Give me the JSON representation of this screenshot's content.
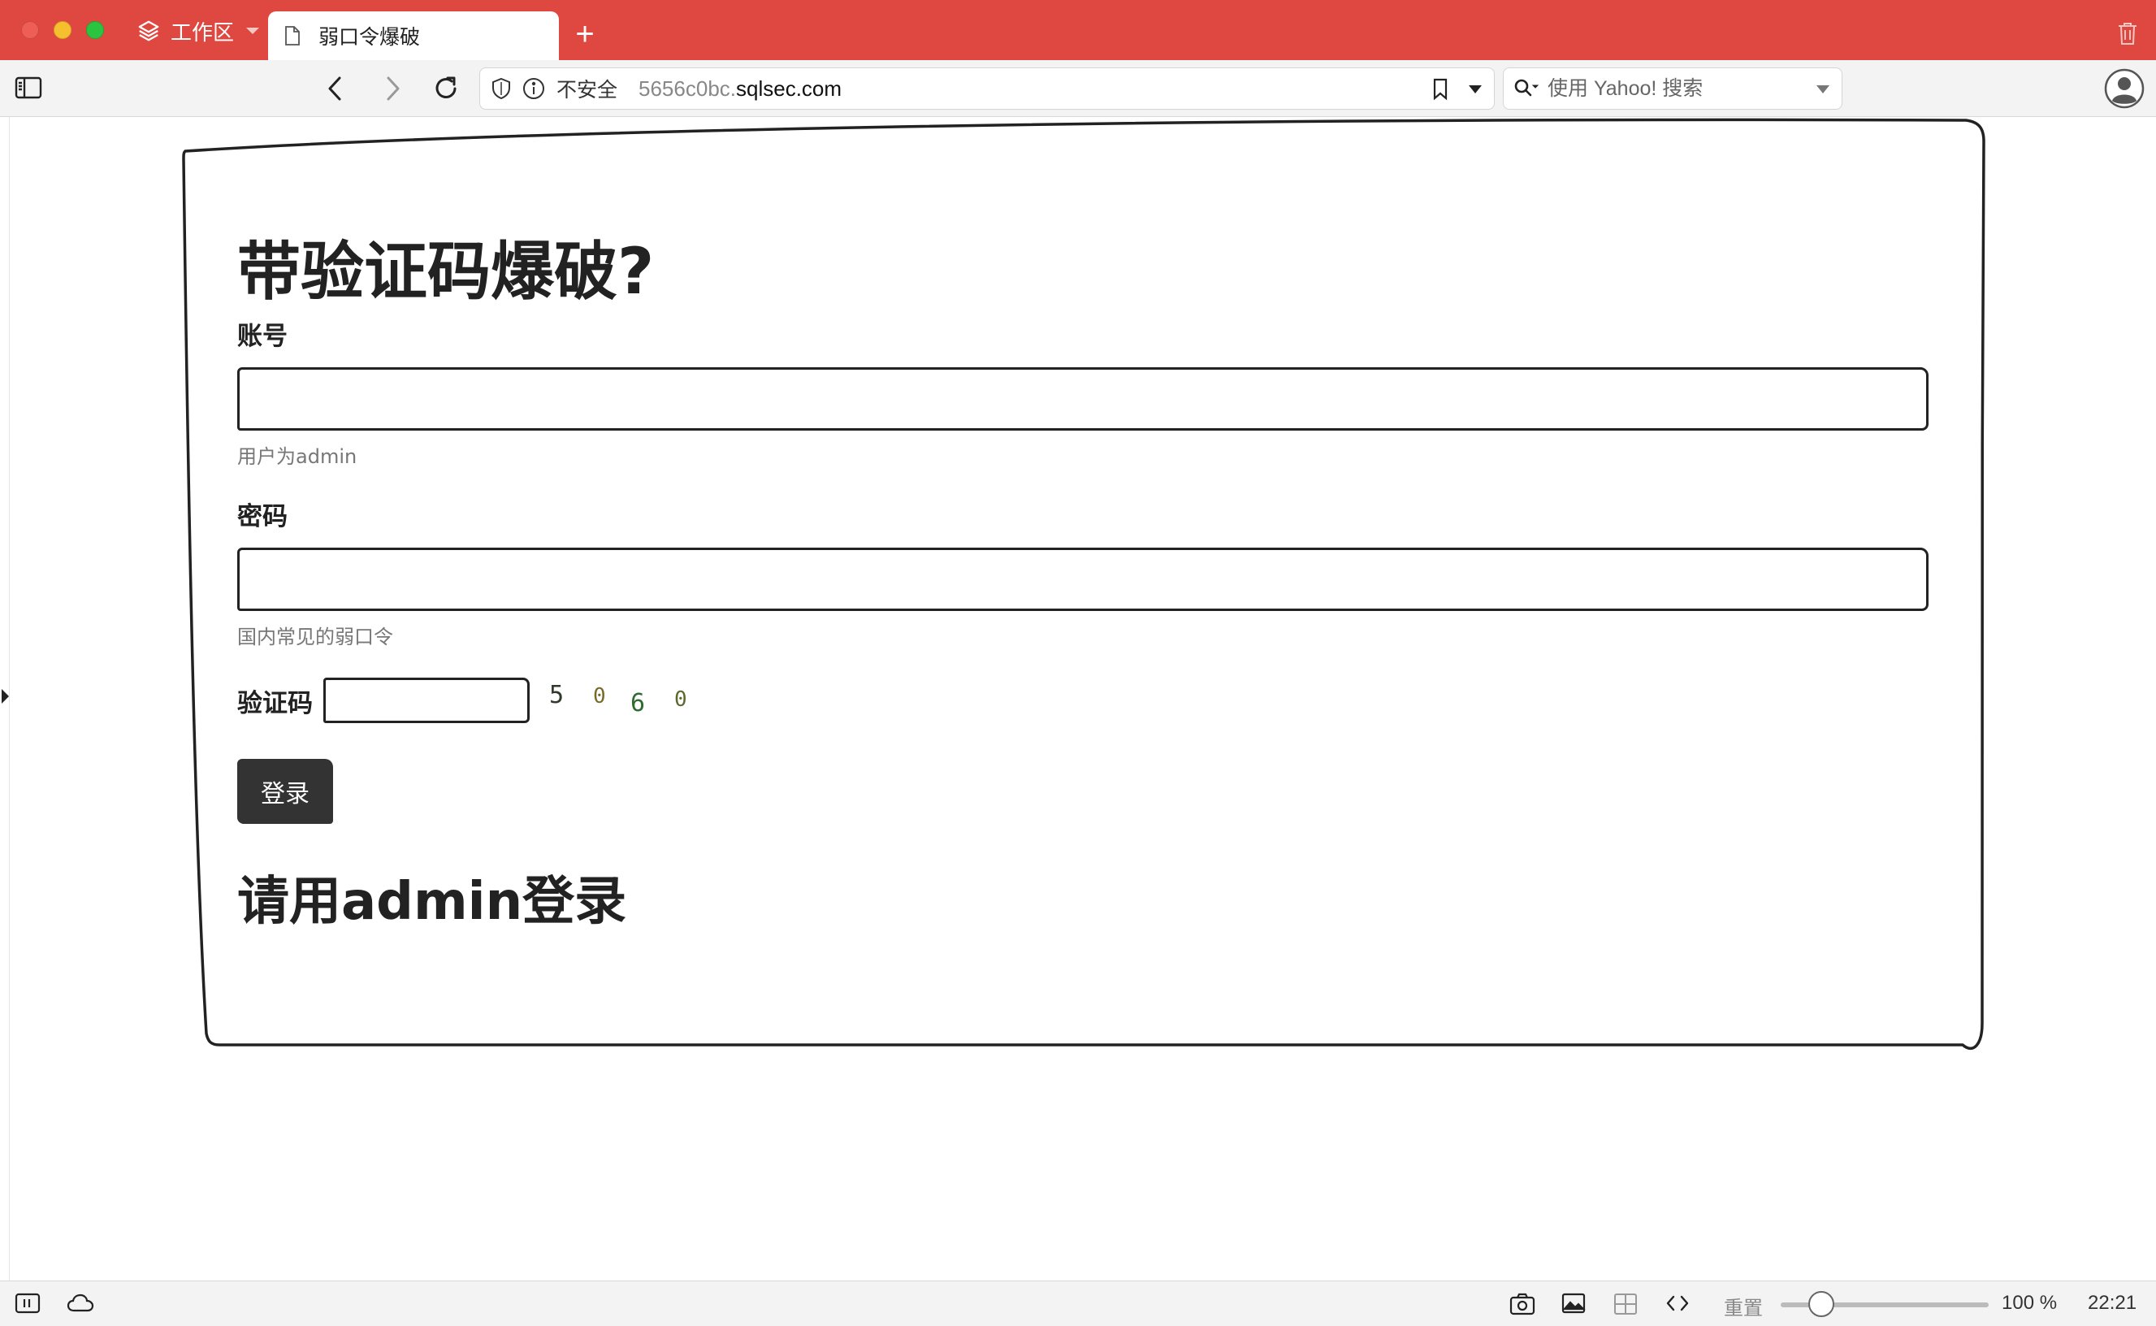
{
  "browser": {
    "workspace_label": "工作区",
    "tab_title": "弱口令爆破",
    "new_tab": "+",
    "security_label": "不安全",
    "url_prefix": "5656c0bc.",
    "url_domain": "sqlsec.com",
    "search_placeholder": "使用 Yahoo! 搜索",
    "colors": {
      "tabbar": "#df4841",
      "toolbar": "#f3f3f3"
    }
  },
  "page": {
    "heading": "带验证码爆破?",
    "username": {
      "label": "账号",
      "value": "",
      "hint": "用户为admin"
    },
    "password": {
      "label": "密码",
      "value": "",
      "hint": "国内常见的弱口令"
    },
    "captcha": {
      "label": "验证码",
      "value": "",
      "digits": [
        "5",
        "0",
        "6",
        "0"
      ],
      "digit_colors": [
        "#2f3a2a",
        "#7a6a2a",
        "#2f6b2f",
        "#5a6a2a"
      ]
    },
    "login_button": "登录",
    "result_message": "请用admin登录"
  },
  "statusbar": {
    "reset_label": "重置",
    "zoom_level": "100 %",
    "zoom_fraction": 0.13,
    "clock": "22:21"
  }
}
